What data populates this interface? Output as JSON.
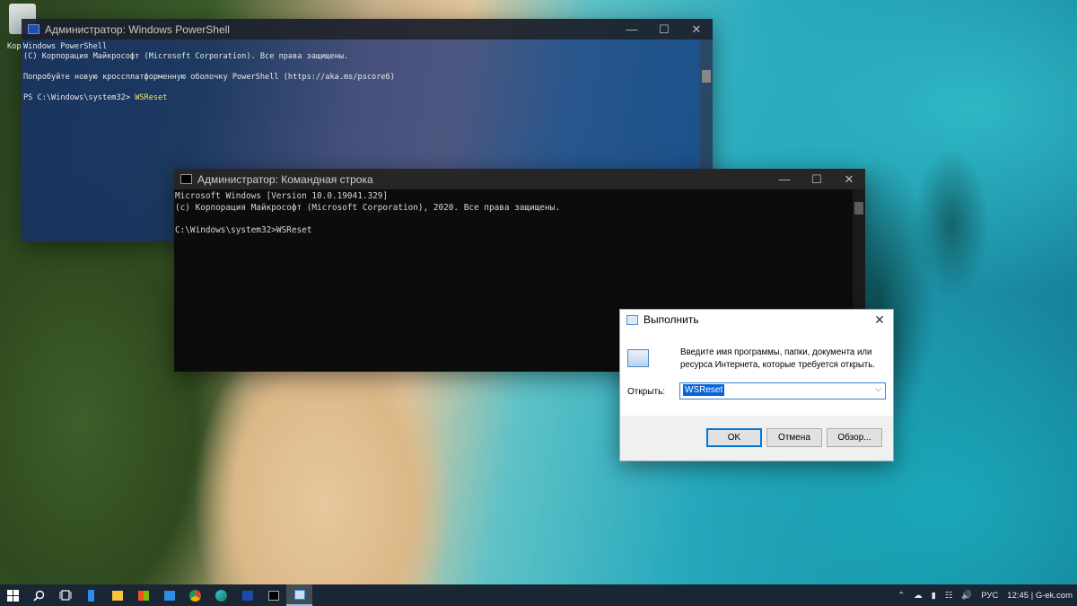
{
  "powershell": {
    "title": "Администратор: Windows PowerShell",
    "overflow_text": "Кор",
    "lines": [
      "Windows PowerShell",
      "(C) Корпорация Майкрософт (Microsoft Corporation). Все права защищены.",
      "",
      "Попробуйте новую кроссплатформенную оболочку PowerShell (https://aka.ms/pscore6)",
      ""
    ],
    "prompt": "PS C:\\Windows\\system32> ",
    "command": "WSReset"
  },
  "cmd": {
    "title": "Администратор: Командная строка",
    "text": "Microsoft Windows [Version 10.0.19041.329]\n(c) Корпорация Майкрософт (Microsoft Corporation), 2020. Все права защищены.\n\nC:\\Windows\\system32>WSReset"
  },
  "run_dialog": {
    "title": "Выполнить",
    "description": "Введите имя программы, папки, документа или ресурса Интернета, которые требуется открыть.",
    "open_label": "Открыть:",
    "input_value": "WSReset",
    "ok_label": "OK",
    "cancel_label": "Отмена",
    "browse_label": "Обзор..."
  },
  "window_controls": {
    "minimize": "—",
    "maximize": "☐",
    "close": "✕"
  },
  "taskbar": {
    "pinned": [
      "windows-start-icon",
      "search-icon",
      "task-view-icon",
      "phone-icon",
      "file-explorer-icon",
      "store-icon",
      "mail-icon",
      "chrome-icon",
      "edge-icon",
      "powershell-icon",
      "cmd-icon",
      "run-icon"
    ],
    "language": "РУС",
    "clock": "12:45 | G-ek.com"
  },
  "colors": {
    "taskbar": "#1a2633",
    "powershell_bg": "#122d76",
    "ps_command": "#f4e45f",
    "selection": "#0a64d8",
    "accent": "#0078d7"
  }
}
